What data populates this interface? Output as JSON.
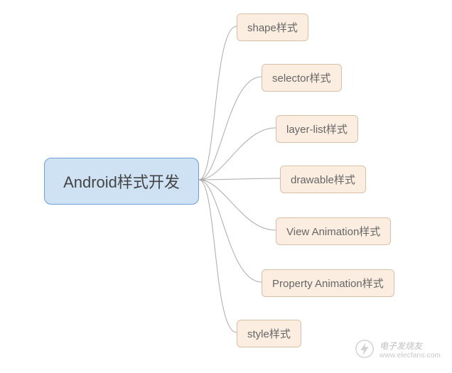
{
  "root": {
    "label": "Android样式开发"
  },
  "children": [
    {
      "label": "shape样式"
    },
    {
      "label": "selector样式"
    },
    {
      "label": "layer-list样式"
    },
    {
      "label": "drawable样式"
    },
    {
      "label": "View Animation样式"
    },
    {
      "label": "Property Animation样式"
    },
    {
      "label": "style样式"
    }
  ],
  "watermark": {
    "cn": "电子发烧友",
    "url": "www.elecfans.com"
  }
}
